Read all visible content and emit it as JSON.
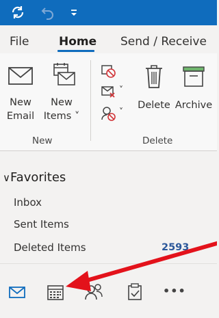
{
  "menu": {
    "tabs": [
      {
        "label": "File"
      },
      {
        "label": "Home"
      },
      {
        "label": "Send / Receive"
      }
    ]
  },
  "ribbon": {
    "new_email": {
      "line1": "New",
      "line2": "Email"
    },
    "new_items": {
      "line1": "New",
      "line2": "Items ˅"
    },
    "delete": {
      "label": "Delete"
    },
    "archive": {
      "label": "Archive"
    },
    "group_new": "New",
    "group_delete": "Delete",
    "dropdown_marker": "˅"
  },
  "folders": {
    "favorites_label": "Favorites",
    "items": [
      {
        "name": "Inbox",
        "count": ""
      },
      {
        "name": "Sent Items",
        "count": ""
      },
      {
        "name": "Deleted Items",
        "count": "2593"
      }
    ]
  },
  "nav": {
    "buttons": [
      "mail-icon",
      "calendar-icon",
      "people-icon",
      "tasks-icon",
      "more-icon"
    ],
    "more_label": "•••"
  },
  "colors": {
    "accent": "#0f6cbd",
    "arrow": "#e3121b",
    "count": "#2b579a"
  },
  "annotation": {
    "type": "arrow",
    "color": "#e3121b",
    "points_to": "calendar-icon"
  }
}
